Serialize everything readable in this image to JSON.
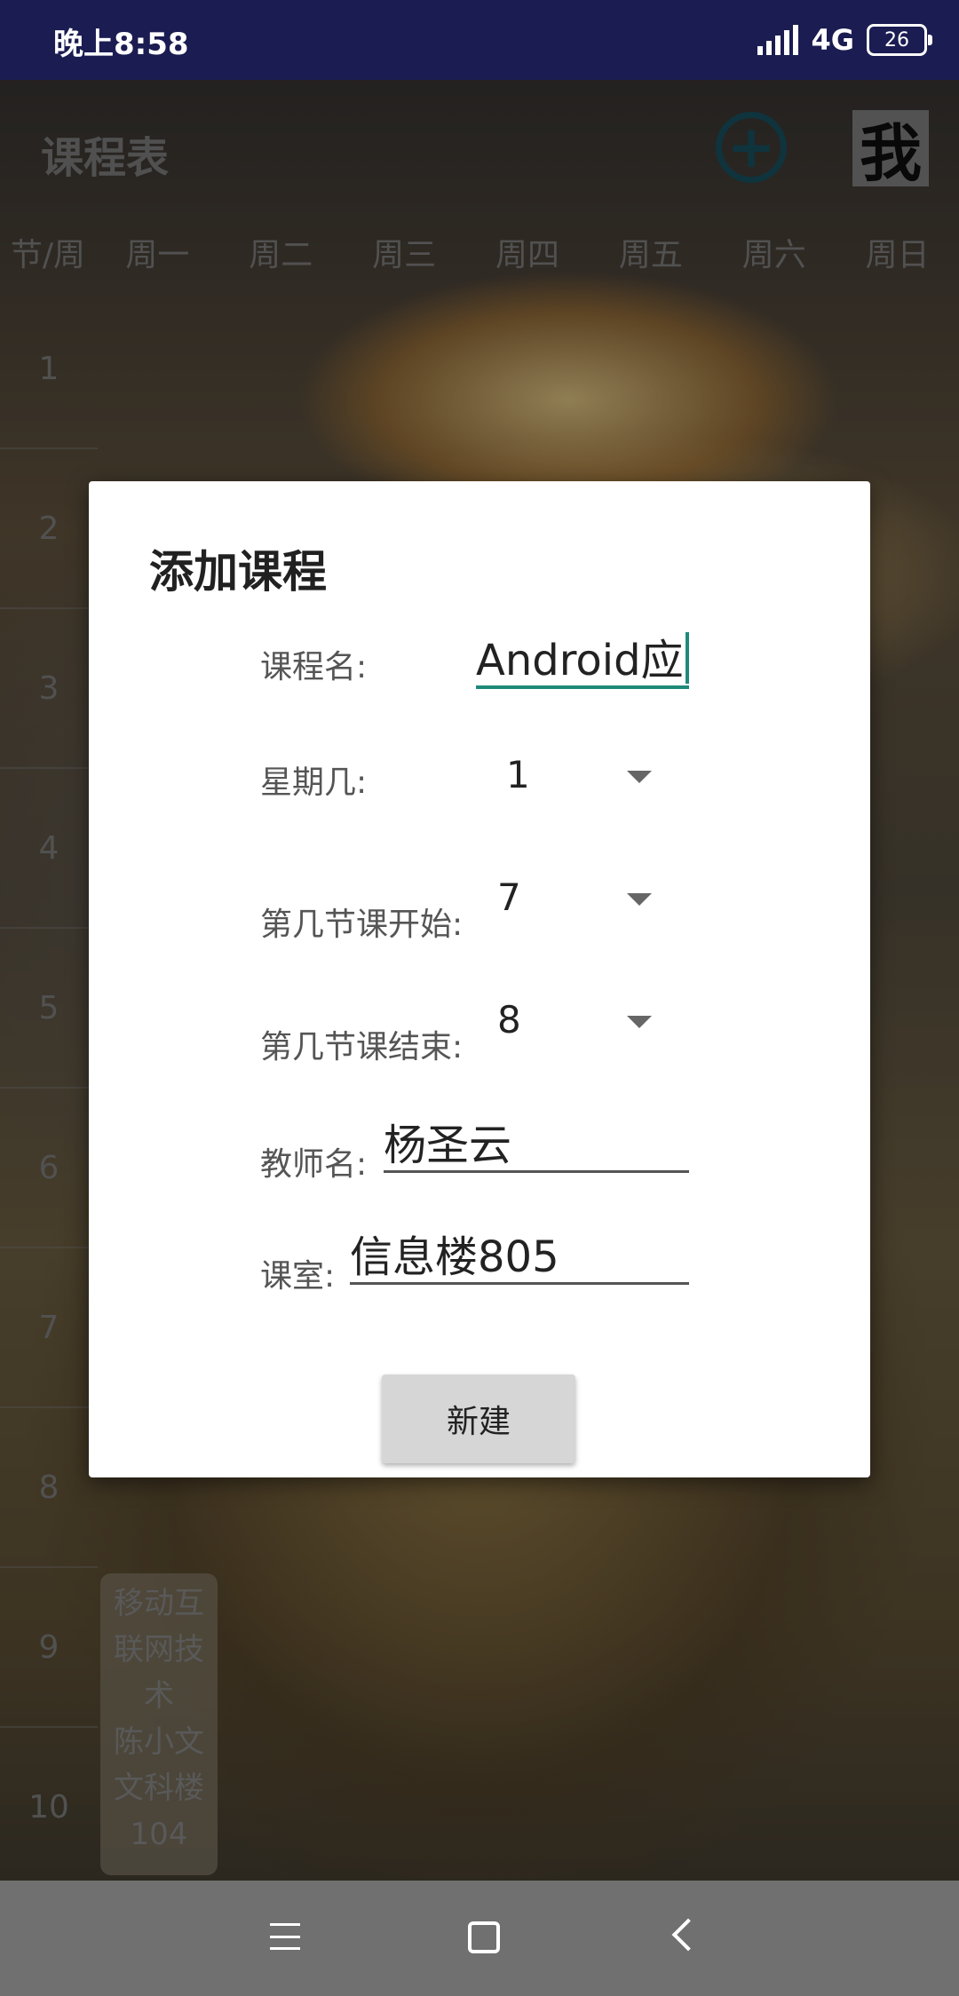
{
  "status": {
    "time": "晚上8:58",
    "network": "4G",
    "battery": "26"
  },
  "app": {
    "title": "课程表",
    "add_icon": "plus-circle-icon",
    "me_label": "我",
    "week_headers": [
      "节/周",
      "周一",
      "周二",
      "周三",
      "周四",
      "周五",
      "周六",
      "周日"
    ],
    "periods": [
      "1",
      "2",
      "3",
      "4",
      "5",
      "6",
      "7",
      "8",
      "9",
      "10"
    ],
    "course_card": {
      "lines": [
        "移动互",
        "联网技",
        "术",
        "陈小文",
        "文科楼",
        "104"
      ]
    }
  },
  "dialog": {
    "title": "添加课程",
    "course_name": {
      "label": "课程名:",
      "value": "Android应"
    },
    "weekday": {
      "label": "星期几:",
      "value": "1"
    },
    "start_period": {
      "label": "第几节课开始:",
      "value": "7"
    },
    "end_period": {
      "label": "第几节课结束:",
      "value": "8"
    },
    "teacher": {
      "label": "教师名:",
      "value": "杨圣云"
    },
    "classroom": {
      "label": "课室:",
      "value": "信息楼805"
    },
    "create_button": "新建"
  },
  "nav": {
    "menu_icon": "menu-icon",
    "home_icon": "home-square-icon",
    "back_icon": "back-chevron-icon"
  }
}
